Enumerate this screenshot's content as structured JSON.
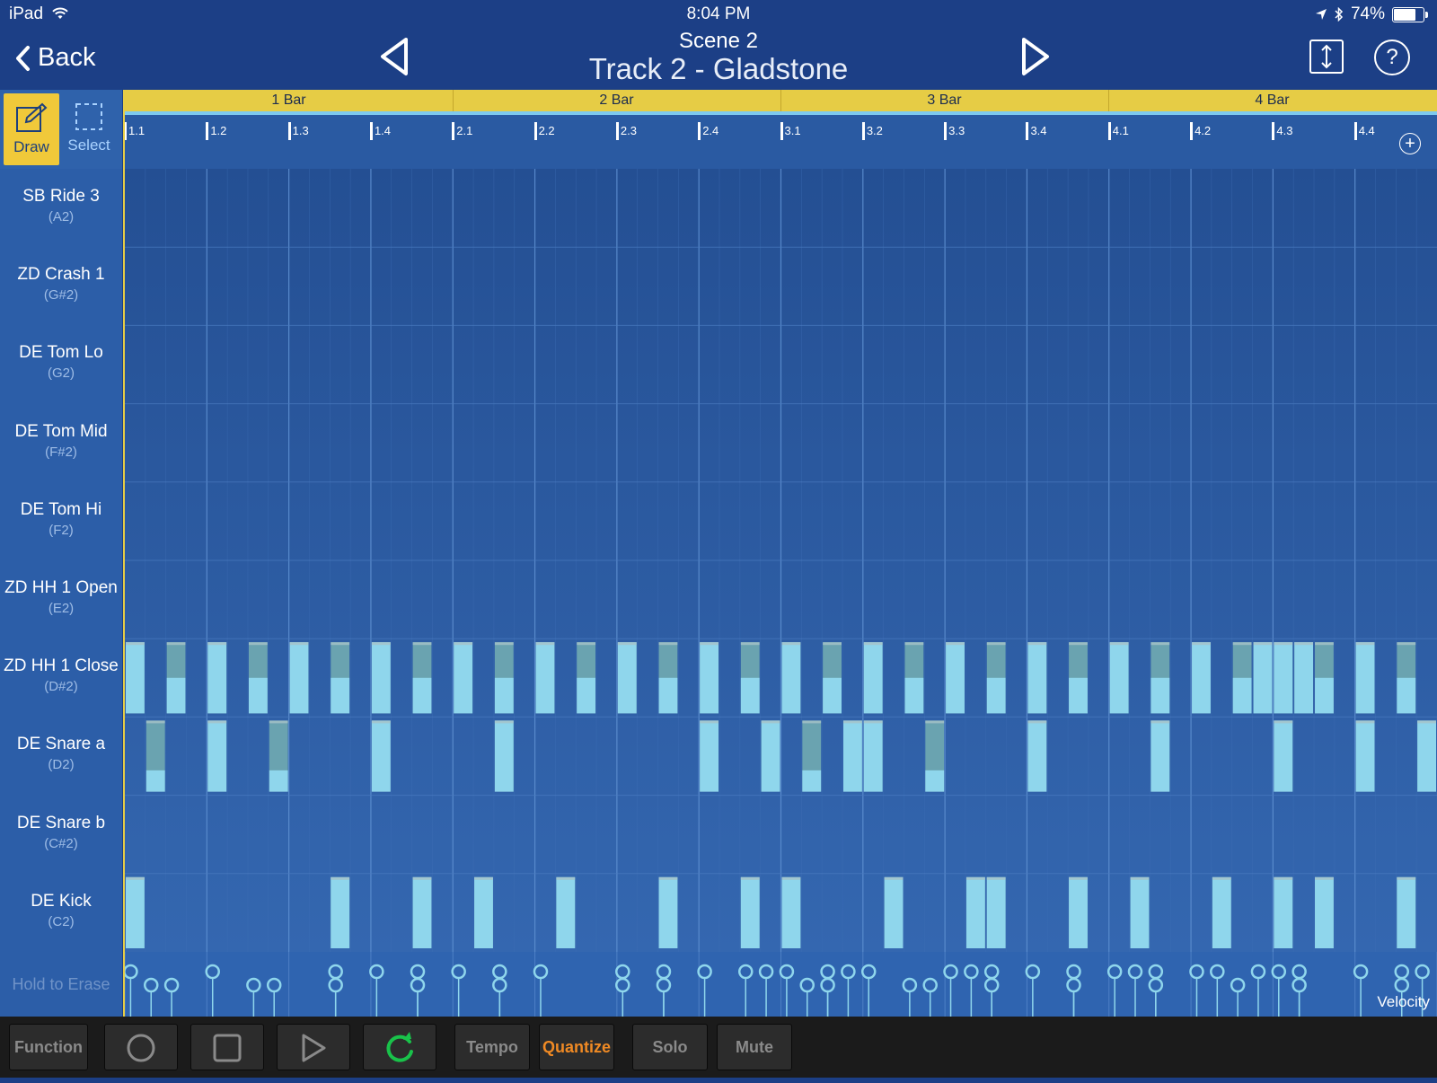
{
  "status": {
    "device": "iPad",
    "time": "8:04 PM",
    "battery": "74%"
  },
  "nav": {
    "back_label": "Back",
    "scene": "Scene  2",
    "track": "Track 2 - Gladstone",
    "icons": {
      "back": "chevron-left-icon",
      "prev": "triangle-left-icon",
      "next": "triangle-right-icon",
      "expand": "vertical-resize-icon",
      "help": "question-icon"
    }
  },
  "tools": {
    "draw_label": "Draw",
    "select_label": "Select",
    "active": "draw"
  },
  "bars": [
    "1 Bar",
    "2 Bar",
    "3 Bar",
    "4 Bar"
  ],
  "beats": [
    "1.1",
    "1.2",
    "1.3",
    "1.4",
    "2.1",
    "2.2",
    "2.3",
    "2.4",
    "3.1",
    "3.2",
    "3.3",
    "3.4",
    "4.1",
    "4.2",
    "4.3",
    "4.4"
  ],
  "lanes": [
    {
      "name": "SB Ride 3",
      "note": "(A2)"
    },
    {
      "name": "ZD Crash 1",
      "note": "(G#2)"
    },
    {
      "name": "DE Tom Lo",
      "note": "(G2)"
    },
    {
      "name": "DE Tom Mid",
      "note": "(F#2)"
    },
    {
      "name": "DE Tom Hi",
      "note": "(F2)"
    },
    {
      "name": "ZD HH 1 Open",
      "note": "(E2)"
    },
    {
      "name": "ZD HH 1 Close",
      "note": "(D#2)"
    },
    {
      "name": "DE Snare a",
      "note": "(D2)"
    },
    {
      "name": "DE Snare b",
      "note": "(C#2)"
    },
    {
      "name": "DE Kick",
      "note": "(C2)"
    }
  ],
  "notes": {
    "hh_close": [
      [
        0,
        1
      ],
      [
        2,
        0.5
      ],
      [
        4,
        1
      ],
      [
        6,
        0.5
      ],
      [
        8,
        1
      ],
      [
        10,
        0.5
      ],
      [
        12,
        1
      ],
      [
        14,
        0.5
      ],
      [
        16,
        1
      ],
      [
        18,
        0.5
      ],
      [
        20,
        1
      ],
      [
        22,
        0.5
      ],
      [
        24,
        1
      ],
      [
        26,
        0.5
      ],
      [
        28,
        1
      ],
      [
        30,
        0.5
      ],
      [
        32,
        1
      ],
      [
        34,
        0.5
      ],
      [
        36,
        1
      ],
      [
        38,
        0.5
      ],
      [
        40,
        1
      ],
      [
        42,
        0.5
      ],
      [
        44,
        1
      ],
      [
        46,
        0.5
      ],
      [
        48,
        1
      ],
      [
        50,
        0.5
      ],
      [
        52,
        1
      ],
      [
        54,
        0.5
      ],
      [
        55,
        1
      ],
      [
        56,
        1
      ],
      [
        57,
        1
      ],
      [
        58,
        0.5
      ],
      [
        60,
        1
      ],
      [
        62,
        0.5
      ]
    ],
    "snare_a": [
      [
        1,
        0.3
      ],
      [
        4,
        1
      ],
      [
        7,
        0.3
      ],
      [
        12,
        1
      ],
      [
        18,
        1
      ],
      [
        28,
        1
      ],
      [
        31,
        1
      ],
      [
        33,
        0.3
      ],
      [
        35,
        1
      ],
      [
        36,
        1
      ],
      [
        39,
        0.3
      ],
      [
        44,
        1
      ],
      [
        50,
        1
      ],
      [
        56,
        1
      ],
      [
        60,
        1
      ],
      [
        63,
        1
      ]
    ],
    "kick": [
      [
        0,
        1
      ],
      [
        10,
        1
      ],
      [
        14,
        1
      ],
      [
        17,
        1
      ],
      [
        21,
        1
      ],
      [
        26,
        1
      ],
      [
        30,
        1
      ],
      [
        32,
        1
      ],
      [
        37,
        1
      ],
      [
        41,
        1
      ],
      [
        42,
        1
      ],
      [
        46,
        1
      ],
      [
        49,
        1
      ],
      [
        53,
        1
      ],
      [
        56,
        1
      ],
      [
        58,
        1
      ],
      [
        62,
        1
      ]
    ]
  },
  "velocity_high": [
    0,
    4,
    10,
    12,
    14,
    16,
    18,
    20,
    24,
    26,
    28,
    30,
    31,
    32,
    34,
    35,
    36,
    40,
    41,
    42,
    44,
    46,
    48,
    49,
    50,
    52,
    53,
    55,
    56,
    57,
    60,
    62,
    63
  ],
  "velocity_low": [
    1,
    2,
    6,
    7,
    10,
    14,
    18,
    24,
    26,
    33,
    34,
    38,
    39,
    42,
    46,
    50,
    54,
    57,
    62
  ],
  "hold_to_erase": "Hold to Erase",
  "velocity_label": "Velocity",
  "transport": {
    "function": "Function",
    "tempo": "Tempo",
    "quantize": "Quantize",
    "solo": "Solo",
    "mute": "Mute",
    "icons": {
      "record": "record-icon",
      "stop": "stop-icon",
      "play": "play-icon",
      "loop": "loop-icon"
    },
    "colors": {
      "quantize": "#f08a24",
      "loop": "#19c24a"
    }
  },
  "colors": {
    "bar_header": "#e6cc45",
    "note": "#8fd6ec",
    "note_dim": "#6aa3b0",
    "draw_active": "#f0c93a"
  }
}
